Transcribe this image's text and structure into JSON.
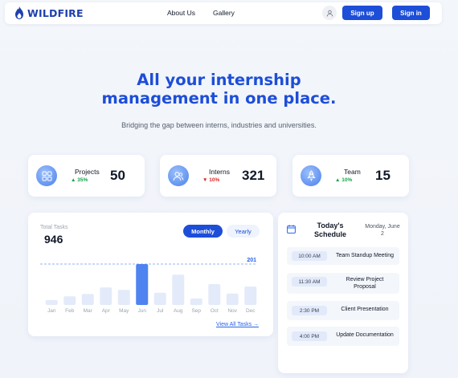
{
  "navbar": {
    "brand": "WILDFIRE",
    "links": [
      "About Us",
      "Gallery"
    ],
    "signup_label": "Sign up",
    "signin_label": "Sign in",
    "user_icon": "user-icon"
  },
  "hero": {
    "title": "All your internship\nmanagement in one place.",
    "subtitle": "Bridging the gap between interns, industries and universities."
  },
  "stats": [
    {
      "label": "Projects",
      "value": "50",
      "change": "▲ 35%",
      "trend": "up",
      "icon": "grid-icon"
    },
    {
      "label": "Interns",
      "value": "321",
      "change": "▼ 10%",
      "trend": "down",
      "icon": "users-icon"
    },
    {
      "label": "Team",
      "value": "15",
      "change": "▲ 10%",
      "trend": "up",
      "icon": "rocket-icon"
    }
  ],
  "tasks": {
    "label": "Total Tasks",
    "value": "946",
    "toggle_monthly": "Monthly",
    "toggle_yearly": "Yearly",
    "view_all": "View All Tasks →"
  },
  "schedule": {
    "title": "Today's\nSchedule",
    "date": "Monday, June\n2",
    "events": [
      {
        "time": "10:00 AM",
        "name": "Team Standup Meeting"
      },
      {
        "time": "11:30 AM",
        "name": "Review Project\nProposal"
      },
      {
        "time": "2:30 PM",
        "name": "Client Presentation"
      },
      {
        "time": "4:00 PM",
        "name": "Update Documentation"
      }
    ]
  },
  "colors": {
    "accent": "#1d4ed8",
    "bar": "#e3ebfa",
    "bar_highlight": "#4f83f0",
    "up": "#16a34a",
    "down": "#dc2626"
  },
  "chart_data": {
    "type": "bar",
    "categories": [
      "Jan",
      "Feb",
      "Mar",
      "Apr",
      "May",
      "Jun",
      "Jul",
      "Aug",
      "Sep",
      "Oct",
      "Nov",
      "Dec"
    ],
    "values": [
      12,
      21,
      27,
      43,
      37,
      100,
      30,
      74,
      16,
      51,
      28,
      45
    ],
    "highlight_category": "Jun",
    "reference_line": {
      "value": 201,
      "label": "201",
      "position": 100
    },
    "ylim": [
      0,
      100
    ],
    "grid": false,
    "title": "",
    "xlabel": "",
    "ylabel": ""
  }
}
